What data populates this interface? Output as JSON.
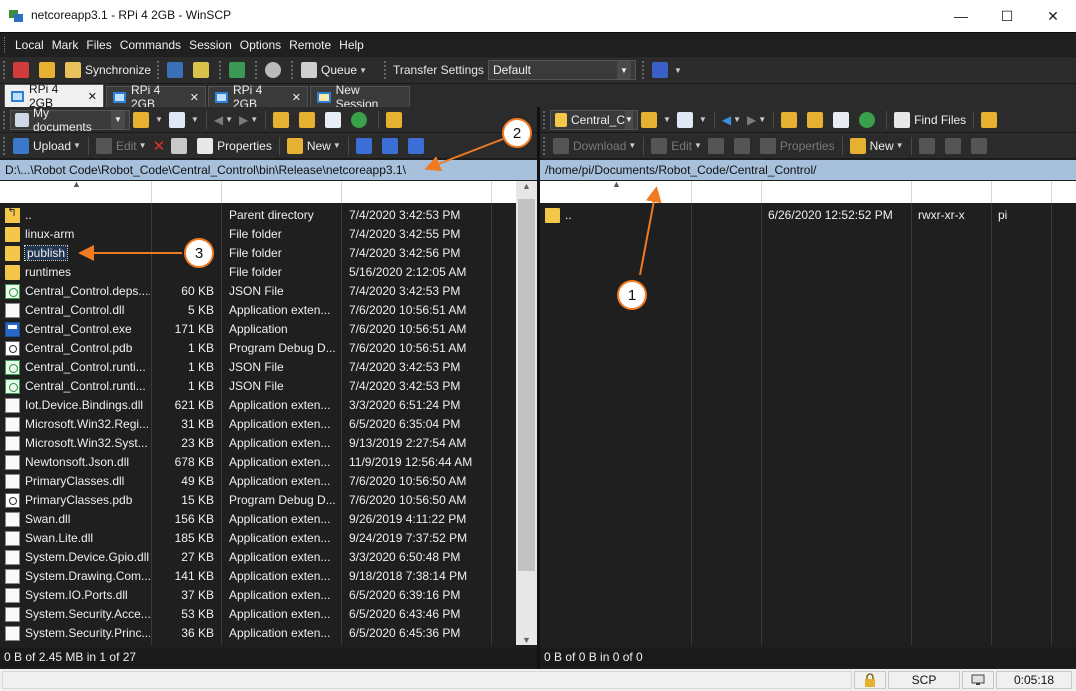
{
  "window": {
    "title": "netcoreapp3.1 - RPi 4 2GB - WinSCP"
  },
  "menu": [
    "Local",
    "Mark",
    "Files",
    "Commands",
    "Session",
    "Options",
    "Remote",
    "Help"
  ],
  "toolbar": {
    "synchronize": "Synchronize",
    "queue": "Queue",
    "transfer_settings_label": "Transfer Settings",
    "transfer_settings_value": "Default"
  },
  "tabs": [
    {
      "label": "RPi 4 2GB",
      "active": true
    },
    {
      "label": "RPi 4 2GB",
      "active": false
    },
    {
      "label": "RPi 4 2GB",
      "active": false
    },
    {
      "label": "New Session",
      "active": false
    }
  ],
  "left_panel": {
    "location": "My documents",
    "upload": "Upload",
    "edit": "Edit",
    "properties": "Properties",
    "new": "New",
    "path": "D:\\...\\Robot Code\\Robot_Code\\Central_Control\\bin\\Release\\netcoreapp3.1\\",
    "files": [
      {
        "name": "..",
        "size": "",
        "type": "Parent directory",
        "changed": "7/4/2020  3:42:53 PM",
        "icon": "up"
      },
      {
        "name": "linux-arm",
        "size": "",
        "type": "File folder",
        "changed": "7/4/2020  3:42:55 PM",
        "icon": "folder"
      },
      {
        "name": "publish",
        "size": "",
        "type": "File folder",
        "changed": "7/4/2020  3:42:56 PM",
        "icon": "folder"
      },
      {
        "name": "runtimes",
        "size": "",
        "type": "File folder",
        "changed": "5/16/2020  2:12:05 AM",
        "icon": "folder"
      },
      {
        "name": "Central_Control.deps....",
        "size": "60 KB",
        "type": "JSON File",
        "changed": "7/4/2020  3:42:53 PM",
        "icon": "json"
      },
      {
        "name": "Central_Control.dll",
        "size": "5 KB",
        "type": "Application exten...",
        "changed": "7/6/2020  10:56:51 AM",
        "icon": "doc"
      },
      {
        "name": "Central_Control.exe",
        "size": "171 KB",
        "type": "Application",
        "changed": "7/6/2020  10:56:51 AM",
        "icon": "exe"
      },
      {
        "name": "Central_Control.pdb",
        "size": "1 KB",
        "type": "Program Debug D...",
        "changed": "7/6/2020  10:56:51 AM",
        "icon": "pdb"
      },
      {
        "name": "Central_Control.runti...",
        "size": "1 KB",
        "type": "JSON File",
        "changed": "7/4/2020  3:42:53 PM",
        "icon": "json"
      },
      {
        "name": "Central_Control.runti...",
        "size": "1 KB",
        "type": "JSON File",
        "changed": "7/4/2020  3:42:53 PM",
        "icon": "json"
      },
      {
        "name": "Iot.Device.Bindings.dll",
        "size": "621 KB",
        "type": "Application exten...",
        "changed": "3/3/2020  6:51:24 PM",
        "icon": "doc"
      },
      {
        "name": "Microsoft.Win32.Regi...",
        "size": "31 KB",
        "type": "Application exten...",
        "changed": "6/5/2020  6:35:04 PM",
        "icon": "doc"
      },
      {
        "name": "Microsoft.Win32.Syst...",
        "size": "23 KB",
        "type": "Application exten...",
        "changed": "9/13/2019  2:27:54 AM",
        "icon": "doc"
      },
      {
        "name": "Newtonsoft.Json.dll",
        "size": "678 KB",
        "type": "Application exten...",
        "changed": "11/9/2019  12:56:44 AM",
        "icon": "doc"
      },
      {
        "name": "PrimaryClasses.dll",
        "size": "49 KB",
        "type": "Application exten...",
        "changed": "7/6/2020  10:56:50 AM",
        "icon": "doc"
      },
      {
        "name": "PrimaryClasses.pdb",
        "size": "15 KB",
        "type": "Program Debug D...",
        "changed": "7/6/2020  10:56:50 AM",
        "icon": "pdb"
      },
      {
        "name": "Swan.dll",
        "size": "156 KB",
        "type": "Application exten...",
        "changed": "9/26/2019  4:11:22 PM",
        "icon": "doc"
      },
      {
        "name": "Swan.Lite.dll",
        "size": "185 KB",
        "type": "Application exten...",
        "changed": "9/24/2019  7:37:52 PM",
        "icon": "doc"
      },
      {
        "name": "System.Device.Gpio.dll",
        "size": "27 KB",
        "type": "Application exten...",
        "changed": "3/3/2020  6:50:48 PM",
        "icon": "doc"
      },
      {
        "name": "System.Drawing.Com...",
        "size": "141 KB",
        "type": "Application exten...",
        "changed": "9/18/2018  7:38:14 PM",
        "icon": "doc"
      },
      {
        "name": "System.IO.Ports.dll",
        "size": "37 KB",
        "type": "Application exten...",
        "changed": "6/5/2020  6:39:16 PM",
        "icon": "doc"
      },
      {
        "name": "System.Security.Acce...",
        "size": "53 KB",
        "type": "Application exten...",
        "changed": "6/5/2020  6:43:46 PM",
        "icon": "doc"
      },
      {
        "name": "System.Security.Princ...",
        "size": "36 KB",
        "type": "Application exten...",
        "changed": "6/5/2020  6:45:36 PM",
        "icon": "doc"
      }
    ],
    "status": "0 B of 2.45 MB in 1 of 27"
  },
  "right_panel": {
    "location": "Central_C",
    "download": "Download",
    "edit": "Edit",
    "properties": "Properties",
    "new": "New",
    "find_files": "Find Files",
    "path": "/home/pi/Documents/Robot_Code/Central_Control/",
    "files": [
      {
        "name": "..",
        "changed": "6/26/2020 12:52:52 PM",
        "rights": "rwxr-xr-x",
        "owner": "pi"
      }
    ],
    "status": "0 B of 0 B in 0 of 0"
  },
  "bottom_status": {
    "protocol": "SCP",
    "time": "0:05:18"
  },
  "annotations": [
    "1",
    "2",
    "3"
  ],
  "colors": {
    "arrow": "#f07a22",
    "path_bar": "#a7c1dc",
    "selection": "#f4c74b"
  }
}
